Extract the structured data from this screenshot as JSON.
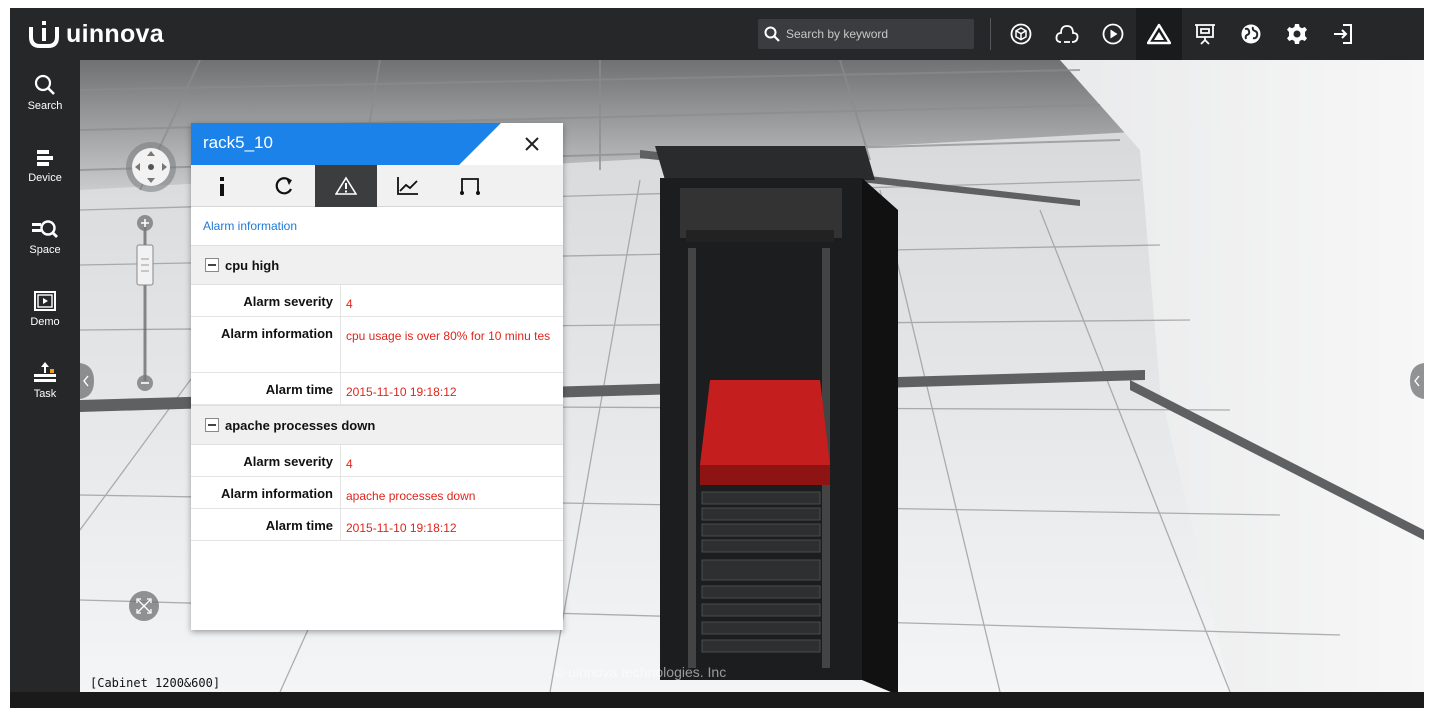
{
  "app": {
    "brand": "uinnova",
    "search_placeholder": "Search by keyword"
  },
  "toolbar": {
    "icons": [
      "3d-box-icon",
      "cloud-icon",
      "play-icon",
      "alarm-triangle-icon",
      "projector-icon",
      "globe-icon",
      "settings-gear-icon",
      "logout-icon"
    ],
    "active": "alarm-triangle-icon"
  },
  "sidebar": {
    "items": [
      {
        "label": "Search",
        "icon": "search-icon"
      },
      {
        "label": "Device",
        "icon": "device-icon"
      },
      {
        "label": "Space",
        "icon": "space-icon"
      },
      {
        "label": "Demo",
        "icon": "demo-icon"
      },
      {
        "label": "Task",
        "icon": "task-icon"
      }
    ]
  },
  "panel": {
    "title": "rack5_10",
    "header_color": "#1a82e8",
    "tabs": [
      "info-icon",
      "refresh-icon",
      "alarm-icon",
      "chart-icon",
      "port-icon"
    ],
    "active_tab": "alarm-icon",
    "section_title": "Alarm information",
    "alarms": [
      {
        "name": "cpu high",
        "rows": [
          {
            "key": "Alarm severity",
            "value": "4"
          },
          {
            "key": "Alarm information",
            "value": "cpu usage is over 80% for 10 minu tes"
          },
          {
            "key": "Alarm time",
            "value": "2015-11-10 19:18:12"
          }
        ]
      },
      {
        "name": "apache processes down",
        "rows": [
          {
            "key": "Alarm severity",
            "value": "4"
          },
          {
            "key": "Alarm information",
            "value": "apache processes down"
          },
          {
            "key": "Alarm time",
            "value": "2015-11-10 19:18:12"
          }
        ]
      }
    ]
  },
  "scene": {
    "view_text": "[Cabinet 1200&600]",
    "watermark": "© uinnova technologies. Inc",
    "alarm_color": "#d11f1f"
  }
}
